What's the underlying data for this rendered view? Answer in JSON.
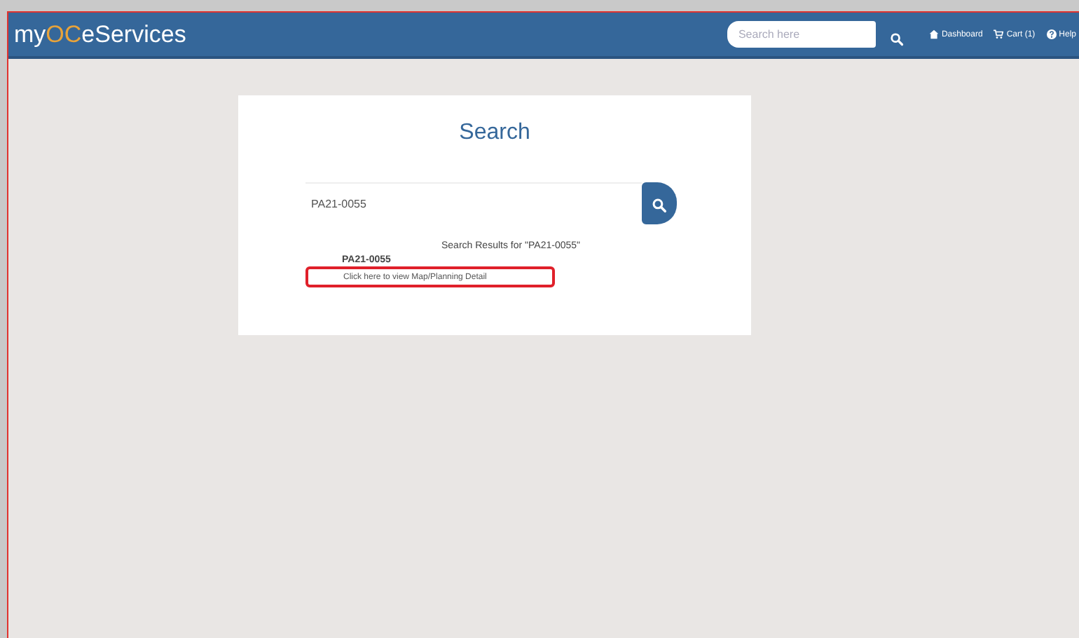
{
  "navbar": {
    "logo": {
      "prefix": "my",
      "accent": "OC",
      "suffix": "eServices"
    },
    "search": {
      "placeholder": "Search here"
    },
    "links": [
      {
        "kind": "dashboard",
        "label": "Dashboard"
      },
      {
        "kind": "cart",
        "label": "Cart (1)"
      },
      {
        "kind": "help",
        "label": "Help"
      }
    ]
  },
  "card": {
    "title": "Search",
    "search": {
      "value": "PA21-0055"
    },
    "results_heading": "Search Results for \"PA21-0055\"",
    "results": [
      {
        "id": "PA21-0055",
        "link": "Click here to view Map/Planning Detail",
        "highlighted": true
      }
    ]
  }
}
